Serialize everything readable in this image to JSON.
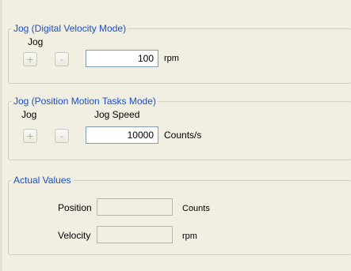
{
  "jog_velocity": {
    "title": "Jog (Digital Velocity Mode)",
    "jog_label": "Jog",
    "plus": "+",
    "minus": "-",
    "value": "100",
    "unit": "rpm"
  },
  "jog_position": {
    "title": "Jog (Position Motion Tasks Mode)",
    "jog_label": "Jog",
    "speed_label": "Jog Speed",
    "plus": "+",
    "minus": "-",
    "value": "10000",
    "unit": "Counts/s"
  },
  "actual_values": {
    "title": "Actual Values",
    "position_label": "Position",
    "position_value": "",
    "position_unit": "Counts",
    "velocity_label": "Velocity",
    "velocity_value": "",
    "velocity_unit": "rpm"
  },
  "colors": {
    "group_title": "#1a4fd1",
    "background": "#f1efe2",
    "border": "#d0d0bf"
  }
}
